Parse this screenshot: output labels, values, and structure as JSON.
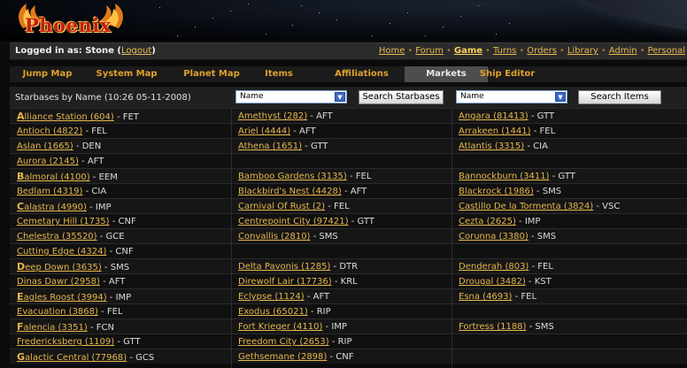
{
  "brand": {
    "logo_text": "Phoenix"
  },
  "login": {
    "label": "Logged in as: Stone",
    "logout": "Logout"
  },
  "topnav": [
    {
      "label": "Home",
      "active": false
    },
    {
      "label": "Forum",
      "active": false
    },
    {
      "label": "Game",
      "active": true
    },
    {
      "label": "Turns",
      "active": false
    },
    {
      "label": "Orders",
      "active": false
    },
    {
      "label": "Library",
      "active": false
    },
    {
      "label": "Admin",
      "active": false
    },
    {
      "label": "Personal",
      "active": false
    }
  ],
  "tabs": [
    {
      "label": "Jump Map",
      "active": false
    },
    {
      "label": "System Map",
      "active": false
    },
    {
      "label": "Planet Map",
      "active": false
    },
    {
      "label": "Items",
      "active": false
    },
    {
      "label": "Affiliations",
      "active": false
    },
    {
      "label": "Markets",
      "active": true
    },
    {
      "label": "Ship Editor",
      "active": false
    }
  ],
  "search": {
    "title": "Starbases by Name (10:26 05-11-2008)",
    "starbase_select": "Name",
    "starbase_button": "Search Starbases",
    "item_select": "Name",
    "item_button": "Search Items"
  },
  "rows": [
    [
      {
        "name": "Alliance Station (604)",
        "aff": "FET",
        "initial": true
      },
      {
        "name": "Amethyst (282)",
        "aff": "AFT"
      },
      {
        "name": "Angara (81413)",
        "aff": "GTT"
      }
    ],
    [
      {
        "name": "Antioch (4822)",
        "aff": "FEL"
      },
      {
        "name": "Ariel (4444)",
        "aff": "AFT"
      },
      {
        "name": "Arrakeen (1441)",
        "aff": "FEL"
      }
    ],
    [
      {
        "name": "Aslan (1665)",
        "aff": "DEN"
      },
      {
        "name": "Athena (1651)",
        "aff": "GTT"
      },
      {
        "name": "Atlantis (3315)",
        "aff": "CIA"
      }
    ],
    [
      {
        "name": "Aurora (2145)",
        "aff": "AFT"
      },
      null,
      null
    ],
    [
      {
        "name": "Balmoral (4100)",
        "aff": "EEM",
        "initial": true
      },
      {
        "name": "Bamboo Gardens (3135)",
        "aff": "FEL"
      },
      {
        "name": "Bannockburn (3411)",
        "aff": "GTT"
      }
    ],
    [
      {
        "name": "Bedlam (4319)",
        "aff": "CIA"
      },
      {
        "name": "Blackbird's Nest (4428)",
        "aff": "AFT"
      },
      {
        "name": "Blackrock (1986)",
        "aff": "SMS"
      }
    ],
    [
      {
        "name": "Calastra (4990)",
        "aff": "IMP",
        "initial": true
      },
      {
        "name": "Carnival Of Rust (2)",
        "aff": "FEL"
      },
      {
        "name": "Castillo De la Tormenta (3824)",
        "aff": "VSC"
      }
    ],
    [
      {
        "name": "Cemetary Hill (1735)",
        "aff": "CNF"
      },
      {
        "name": "Centrepoint City (97421)",
        "aff": "GTT"
      },
      {
        "name": "Cezta (2625)",
        "aff": "IMP"
      }
    ],
    [
      {
        "name": "Chelestra (35520)",
        "aff": "GCE"
      },
      {
        "name": "Convallis (2810)",
        "aff": "SMS"
      },
      {
        "name": "Corunna (3380)",
        "aff": "SMS"
      }
    ],
    [
      {
        "name": "Cutting Edge (4324)",
        "aff": "CNF"
      },
      null,
      null
    ],
    [
      {
        "name": "Deep Down (3635)",
        "aff": "SMS",
        "initial": true
      },
      {
        "name": "Delta Pavonis (1285)",
        "aff": "DTR"
      },
      {
        "name": "Denderah (803)",
        "aff": "FEL"
      }
    ],
    [
      {
        "name": "Dinas Dawr (2958)",
        "aff": "AFT"
      },
      {
        "name": "Direwolf Lair (17736)",
        "aff": "KRL"
      },
      {
        "name": "Drougal (3482)",
        "aff": "KST"
      }
    ],
    [
      {
        "name": "Eagles Roost (3994)",
        "aff": "IMP",
        "initial": true
      },
      {
        "name": "Eclypse (1124)",
        "aff": "AFT"
      },
      {
        "name": "Esna (4693)",
        "aff": "FEL"
      }
    ],
    [
      {
        "name": "Evacuation (3868)",
        "aff": "FEL"
      },
      {
        "name": "Exodus (65021)",
        "aff": "RIP"
      },
      null
    ],
    [
      {
        "name": "Falencia (3351)",
        "aff": "FCN",
        "initial": true
      },
      {
        "name": "Fort Krieger (4110)",
        "aff": "IMP"
      },
      {
        "name": "Fortress (1188)",
        "aff": "SMS"
      }
    ],
    [
      {
        "name": "Fredericksberg (1109)",
        "aff": "GTT"
      },
      {
        "name": "Freedom City (2653)",
        "aff": "RIP"
      },
      null
    ],
    [
      {
        "name": "Galactic Central (77968)",
        "aff": "GCS",
        "initial": true
      },
      {
        "name": "Gethsemane (2898)",
        "aff": "CNF"
      },
      null
    ]
  ]
}
